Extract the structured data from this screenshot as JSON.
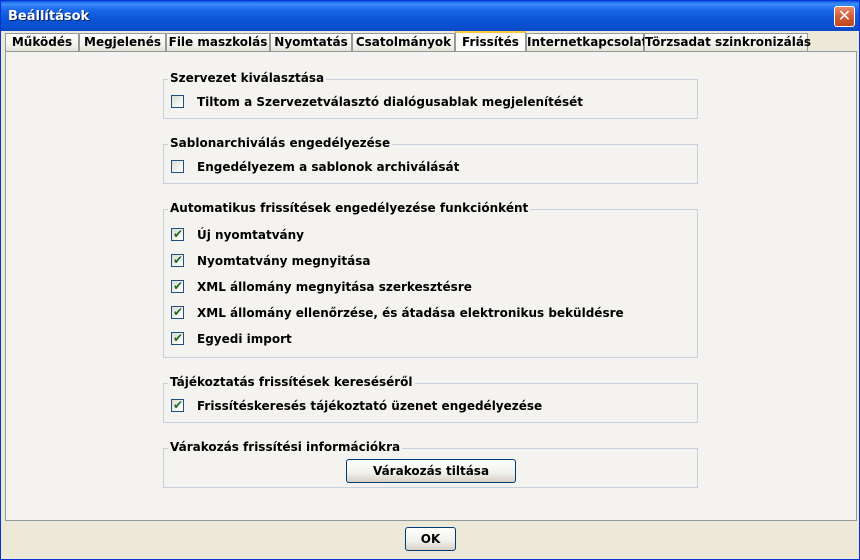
{
  "window": {
    "title": "Beállítások",
    "close_glyph": "✕"
  },
  "tabs": [
    {
      "label": "Működés"
    },
    {
      "label": "Megjelenés"
    },
    {
      "label": "File maszkolás"
    },
    {
      "label": "Nyomtatás"
    },
    {
      "label": "Csatolmányok"
    },
    {
      "label": "Frissítés",
      "active": true
    },
    {
      "label": "Internetkapcsolat"
    },
    {
      "label": "Törzsadat szinkronizálás"
    }
  ],
  "groups": {
    "org": {
      "title": "Szervezet kiválasztása",
      "items": [
        {
          "label": "Tiltom a Szervezetválasztó dialógusablak megjelenítését",
          "checked": false
        }
      ]
    },
    "archive": {
      "title": "Sablonarchiválás engedélyezése",
      "items": [
        {
          "label": "Engedélyezem a sablonok archiválását",
          "checked": false
        }
      ]
    },
    "auto": {
      "title": "Automatikus frissítések engedélyezése funkciónként",
      "items": [
        {
          "label": "Új nyomtatvány",
          "checked": true
        },
        {
          "label": "Nyomtatvány megnyitása",
          "checked": true
        },
        {
          "label": "XML állomány megnyitása szerkesztésre",
          "checked": true
        },
        {
          "label": "XML állomány ellenőrzése, és átadása elektronikus beküldésre",
          "checked": true
        },
        {
          "label": "Egyedi import",
          "checked": true
        }
      ]
    },
    "info": {
      "title": "Tájékoztatás frissítések kereséséről",
      "items": [
        {
          "label": "Frissítéskeresés tájékoztató üzenet engedélyezése",
          "checked": true
        }
      ]
    },
    "wait": {
      "title": "Várakozás frissítési információkra",
      "button_label": "Várakozás tiltása"
    }
  },
  "footer": {
    "ok_label": "OK"
  },
  "check_glyph": "✔",
  "colors": {
    "titlebar": "#0a5ae0",
    "active_tab_accent": "#ffc83c",
    "group_border": "#c5d0dc",
    "close_button": "#d35a34"
  }
}
